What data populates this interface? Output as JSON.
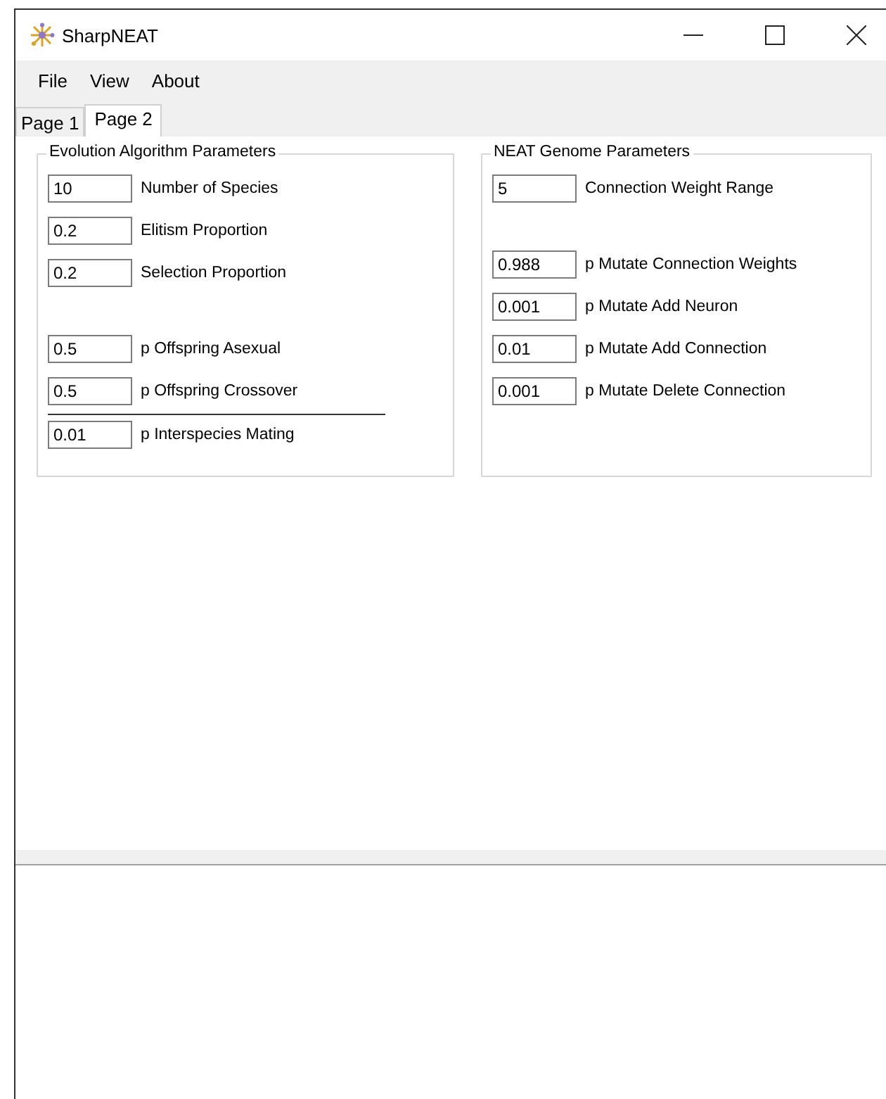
{
  "window": {
    "title": "SharpNEAT"
  },
  "menu": [
    "File",
    "View",
    "About"
  ],
  "tabs": [
    {
      "label": "Page 1",
      "selected": false
    },
    {
      "label": "Page 2",
      "selected": true
    }
  ],
  "groups": [
    {
      "title": "Evolution Algorithm Parameters",
      "items": [
        {
          "kind": "field",
          "value": "10",
          "label": "Number of Species"
        },
        {
          "kind": "field",
          "value": "0.2",
          "label": "Elitism Proportion"
        },
        {
          "kind": "field",
          "value": "0.2",
          "label": "Selection Proportion"
        },
        {
          "kind": "spacer"
        },
        {
          "kind": "field",
          "value": "0.5",
          "label": "p Offspring Asexual"
        },
        {
          "kind": "field",
          "value": "0.5",
          "label": "p Offspring Crossover"
        },
        {
          "kind": "divider"
        },
        {
          "kind": "field",
          "value": "0.01",
          "label": "p Interspecies Mating"
        }
      ]
    },
    {
      "title": "NEAT Genome Parameters",
      "items": [
        {
          "kind": "field",
          "value": "5",
          "label": "Connection Weight Range"
        },
        {
          "kind": "spacer"
        },
        {
          "kind": "field",
          "value": "0.988",
          "label": "p Mutate Connection Weights"
        },
        {
          "kind": "field",
          "value": "0.001",
          "label": "p Mutate Add Neuron"
        },
        {
          "kind": "field",
          "value": "0.01",
          "label": "p Mutate Add Connection"
        },
        {
          "kind": "field",
          "value": "0.001",
          "label": "p Mutate Delete Connection"
        }
      ]
    }
  ]
}
